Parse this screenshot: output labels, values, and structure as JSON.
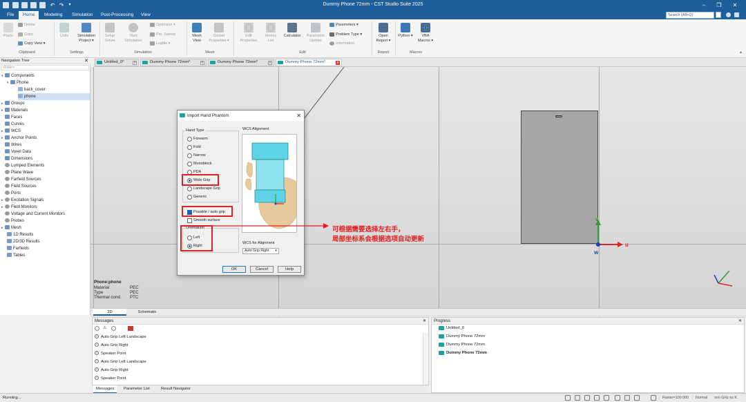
{
  "window": {
    "title": "Dummy Phone 72mm - CST Studio Suite 2025"
  },
  "menu": {
    "tabs": [
      "File",
      "Home",
      "Modeling",
      "Simulation",
      "Post-Processing",
      "View"
    ],
    "active": "Home",
    "search_placeholder": "Search (Alt+Q)"
  },
  "ribbon": {
    "paste": "Paste",
    "delete": "Delete",
    "copy": "Copy",
    "copy_view": "Copy View",
    "units": "Units",
    "simulation_project": "Simulation Project",
    "setup_solver": "Setup Solver",
    "start_simulation": "Start Simulation",
    "optimizer": "Optimizer",
    "par_sweep": "Par. Sweep",
    "logfile": "Logfile",
    "mesh_view": "Mesh View",
    "global_properties": "Global Properties",
    "edit_properties": "Edit Properties",
    "history_list": "History List",
    "calculator": "Calculator",
    "parametric_update": "Parametric Update",
    "parameters": "Parameters",
    "problem_type": "Problem Type",
    "information": "Information",
    "open_report": "Open Report",
    "python": "Python",
    "vba_macros": "VBA Macros",
    "groups": [
      "Clipboard",
      "Settings",
      "Simulation",
      "Mesh",
      "Edit",
      "Report",
      "Macros"
    ]
  },
  "doc_tabs": [
    "Untitled_0*",
    "Dummy Phone 72mm*",
    "Dummy Phone 72mm*",
    "Dummy Phone 72mm*"
  ],
  "nav": {
    "title": "Navigation Tree",
    "filter_placeholder": "<Filter>",
    "items": [
      "Components",
      "Phone",
      "back_cover",
      "phone",
      "Groups",
      "Materials",
      "Faces",
      "Curves",
      "WCS",
      "Anchor Points",
      "Wires",
      "Voxel Data",
      "Dimensions",
      "Lumped Elements",
      "Plane Wave",
      "Farfield Sources",
      "Field Sources",
      "Ports",
      "Excitation Signals",
      "Field Monitors",
      "Voltage and Current Monitors",
      "Probes",
      "Mesh",
      "1D Results",
      "2D/3D Results",
      "Farfields",
      "Tables"
    ]
  },
  "properties": {
    "title": "Phone:phone",
    "rows": [
      {
        "label": "Material",
        "value": "PEC"
      },
      {
        "label": "Type",
        "value": "PEC"
      },
      {
        "label": "Thermal cond.",
        "value": "PTC"
      }
    ]
  },
  "dialog": {
    "title": "Import Hand Phantom",
    "hand_type_label": "Hand Type",
    "hand_types": [
      "Forearm",
      "Fold",
      "Narrow",
      "Monoblock",
      "PDA",
      "Wide Grip",
      "Landscape Grip",
      "Generic"
    ],
    "hand_type_selected": "Wide Grip",
    "posable_label": "Posable / auto grip",
    "posable_checked": true,
    "smooth_label": "Smooth surface",
    "smooth_checked": false,
    "orientation_label": "Orientation",
    "orientations": [
      "Left",
      "Right"
    ],
    "orientation_selected": "Right",
    "wcs_alignment_label": "WCS Alignment",
    "wcs_for_alignment_label": "WCS for Alignment",
    "wcs_for_alignment_value": "Auto Grip Right",
    "ok": "OK",
    "cancel": "Cancel",
    "help": "Help"
  },
  "annotation": {
    "line1": "可根据需要选择左右手，",
    "line2": "局部坐标系会根据选项自动更新",
    "color": "#e02020"
  },
  "axes": {
    "u": "u",
    "v": "v",
    "w": "w"
  },
  "view_tabs": [
    "3D",
    "Schematic"
  ],
  "messages": {
    "title": "Messages",
    "items": [
      "Auto Grip Left Landscape",
      "Auto Grip Right",
      "Speaker Point",
      "Auto Grip Left Landscape",
      "Auto Grip Right",
      "Speaker Point"
    ],
    "tabs": [
      "Messages",
      "Parameter List",
      "Result Navigator"
    ]
  },
  "progress": {
    "title": "Progress",
    "items": [
      "Untitled_0",
      "Dummy Phone 72mm",
      "Dummy Phone 72mm",
      "Dummy Phone 72mm"
    ]
  },
  "status": {
    "text": "Running...",
    "raster": "Raster=100.000",
    "mode": "Normal",
    "units": "mm  GHz  ns  K"
  },
  "colors": {
    "title_bar": "#1e5f99",
    "highlight": "#e02020",
    "accent": "#1565c0",
    "doc_icon": "#1aa3a0"
  }
}
